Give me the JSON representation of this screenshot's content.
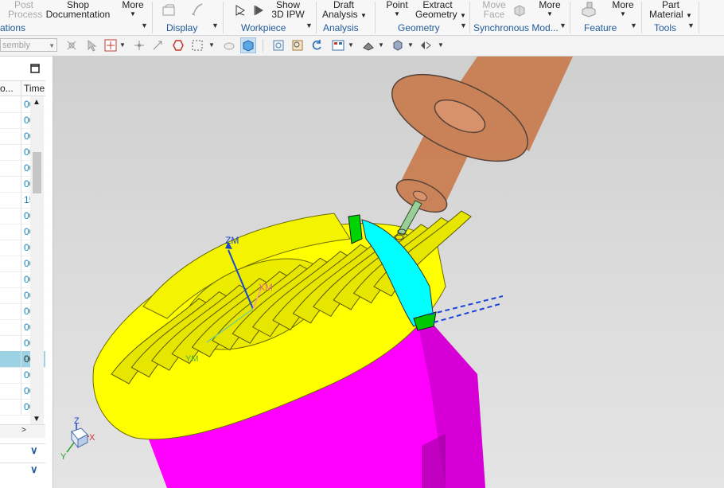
{
  "ribbon": {
    "post_process": [
      "Post",
      "Process"
    ],
    "shop_documentation": [
      "Shop",
      "Documentation"
    ],
    "more_1": "More",
    "show_3d_ipw": [
      "Show",
      "3D IPW"
    ],
    "draft_analysis": [
      "Draft",
      "Analysis"
    ],
    "point": "Point",
    "extract_geometry": [
      "Extract",
      "Geometry"
    ],
    "move_face": [
      "Move",
      "Face"
    ],
    "more_2": "More",
    "more_3": "More",
    "part_material": [
      "Part",
      "Material"
    ],
    "groups": [
      "ations",
      "Display",
      "Workpiece",
      "Analysis",
      "Geometry",
      "Synchronous Mod...",
      "Feature",
      "Tools"
    ]
  },
  "toolbar2": {
    "filter_combo": "sembly"
  },
  "nav_panel": {
    "col_name": "o...",
    "col_time": "Time",
    "rows": [
      "00",
      "00",
      "00",
      "00",
      "00",
      "00",
      "15",
      "00",
      "00",
      "00",
      "00",
      "00",
      "00",
      "00",
      "00",
      "00",
      "00",
      "00",
      "00",
      "00"
    ],
    "selected_row": 16
  },
  "viewport": {
    "labels": {
      "zm": "ZM",
      "xm": "XM",
      "ym": "YM",
      "tz": "Z",
      "tx": "X",
      "ty": "Y"
    },
    "colors": {
      "workpiece": "#ff00ff",
      "impeller": "#ffff00",
      "cut_region": "#00ffff",
      "tool_holder": "#c8703e",
      "axis_blue": "#1a44d8"
    }
  }
}
